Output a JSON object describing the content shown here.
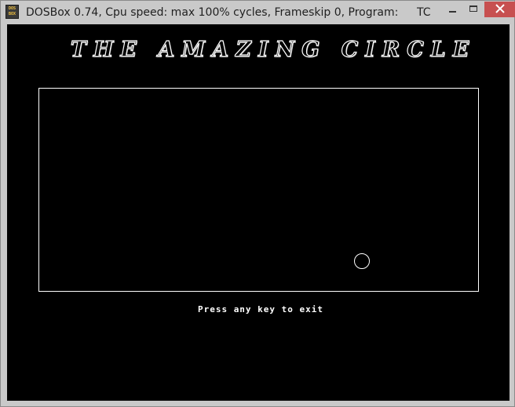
{
  "window": {
    "title": "DOSBox 0.74, Cpu speed: max 100% cycles, Frameskip  0, Program:",
    "title_tail": "TC",
    "icon_label_top": "DOS",
    "icon_label_bottom": "BOX",
    "controls": {
      "minimize": "minimize",
      "maximize": "maximize",
      "close": "close"
    }
  },
  "game": {
    "title": "THE AMAZING CIRCLE",
    "exit_prompt": "Press any key to exit"
  },
  "colors": {
    "screen_background": "#000000",
    "foreground": "#ffffff",
    "titlebar": "#c9c9c9",
    "close_button": "#c75050"
  }
}
